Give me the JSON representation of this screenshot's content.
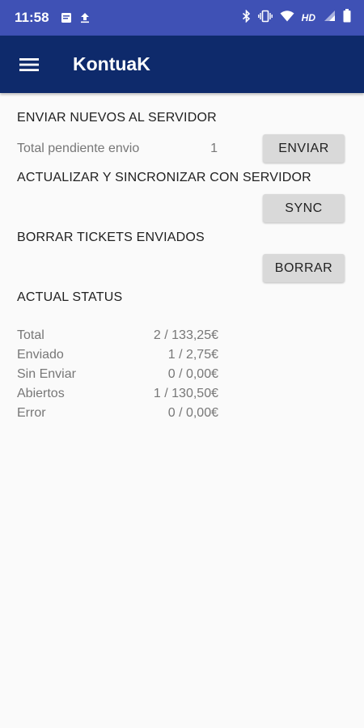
{
  "status_bar": {
    "time": "11:58",
    "hd_label": "HD",
    "icons": [
      "message-icon",
      "upload-icon",
      "bluetooth-icon",
      "vibrate-icon",
      "wifi-icon",
      "signal-icon",
      "battery-icon"
    ]
  },
  "app_bar": {
    "title": "KontuaK",
    "menu_icon": "hamburger-menu-icon",
    "background": "#0e2a6b"
  },
  "send_section": {
    "heading": "ENVIAR NUEVOS AL SERVIDOR",
    "pending_label": "Total pendiente envio",
    "pending_value": "1",
    "button_label": "ENVIAR"
  },
  "sync_section": {
    "heading": "ACTUALIZAR Y SINCRONIZAR CON SERVIDOR",
    "button_label": "SYNC"
  },
  "delete_section": {
    "heading": "BORRAR TICKETS ENVIADOS",
    "button_label": "BORRAR"
  },
  "status_section": {
    "heading": "ACTUAL STATUS",
    "rows": [
      {
        "label": "Total",
        "value": "2 / 133,25€"
      },
      {
        "label": "Enviado",
        "value": "1 / 2,75€"
      },
      {
        "label": "Sin Enviar",
        "value": "0 / 0,00€"
      },
      {
        "label": "Abiertos",
        "value": "1 / 130,50€"
      },
      {
        "label": "Error",
        "value": "0 / 0,00€"
      }
    ]
  }
}
